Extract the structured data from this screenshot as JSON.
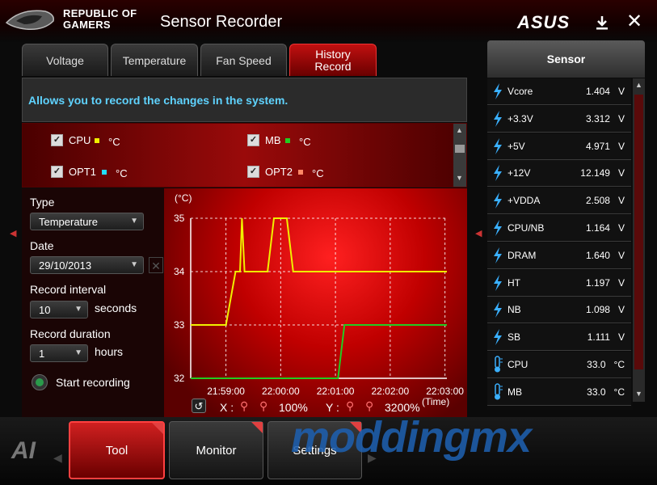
{
  "window": {
    "brand_line1": "REPUBLIC OF",
    "brand_line2": "GAMERS",
    "title": "Sensor Recorder",
    "vendor_logo": "ASUS"
  },
  "tabs": [
    {
      "label": "Voltage"
    },
    {
      "label": "Temperature"
    },
    {
      "label": "Fan Speed"
    },
    {
      "label_line1": "History",
      "label_line2": "Record",
      "active": true
    }
  ],
  "info": "Allows you to record the changes in the system.",
  "sensors_checked": [
    {
      "label": "CPU",
      "unit": "°C",
      "color": "#f0f000",
      "checked": true
    },
    {
      "label": "MB",
      "unit": "°C",
      "color": "#22cc22",
      "checked": true
    },
    {
      "label": "OPT1",
      "unit": "°C",
      "color": "#22ddff",
      "checked": true
    },
    {
      "label": "OPT2",
      "unit": "°C",
      "color": "#ff8866",
      "checked": true
    }
  ],
  "controls": {
    "type_label": "Type",
    "type_value": "Temperature",
    "date_label": "Date",
    "date_value": "29/10/2013",
    "interval_label": "Record interval",
    "interval_value": "10",
    "interval_unit": "seconds",
    "duration_label": "Record duration",
    "duration_value": "1",
    "duration_unit": "hours",
    "start_label": "Start recording"
  },
  "chart_data": {
    "type": "line",
    "ylabel": "(°C)",
    "xlabel": "(Time)",
    "ylim": [
      32,
      35
    ],
    "yticks": [
      "35",
      "34",
      "33",
      "32"
    ],
    "xticks": [
      "21:59:00",
      "22:00:00",
      "22:01:00",
      "22:02:00",
      "22:03:00"
    ],
    "grid": true,
    "series": [
      {
        "name": "CPU",
        "color": "#f0f000",
        "points": [
          [
            0,
            33
          ],
          [
            0.55,
            33
          ],
          [
            0.7,
            34
          ],
          [
            0.77,
            34
          ],
          [
            0.8,
            35
          ],
          [
            0.84,
            34
          ],
          [
            1.0,
            34
          ],
          [
            1.2,
            34
          ],
          [
            1.3,
            35
          ],
          [
            1.5,
            35
          ],
          [
            1.6,
            34
          ],
          [
            4.0,
            34
          ]
        ]
      },
      {
        "name": "MB",
        "color": "#22cc22",
        "points": [
          [
            0,
            32
          ],
          [
            2.3,
            32
          ],
          [
            2.4,
            33
          ],
          [
            4.0,
            33
          ]
        ]
      }
    ]
  },
  "zoom": {
    "x_label": "X :",
    "x_value": "100%",
    "y_label": "Y :",
    "y_value": "3200%"
  },
  "sensor_panel": {
    "title": "Sensor",
    "items": [
      {
        "name": "Vcore",
        "value": "1.404",
        "unit": "V",
        "icon": "lightning-icon"
      },
      {
        "name": "+3.3V",
        "value": "3.312",
        "unit": "V",
        "icon": "lightning-icon"
      },
      {
        "name": "+5V",
        "value": "4.971",
        "unit": "V",
        "icon": "lightning-icon"
      },
      {
        "name": "+12V",
        "value": "12.149",
        "unit": "V",
        "icon": "lightning-icon"
      },
      {
        "name": "+VDDA",
        "value": "2.508",
        "unit": "V",
        "icon": "lightning-icon"
      },
      {
        "name": "CPU/NB",
        "value": "1.164",
        "unit": "V",
        "icon": "lightning-icon"
      },
      {
        "name": "DRAM",
        "value": "1.640",
        "unit": "V",
        "icon": "lightning-icon"
      },
      {
        "name": "HT",
        "value": "1.197",
        "unit": "V",
        "icon": "lightning-icon"
      },
      {
        "name": "NB",
        "value": "1.098",
        "unit": "V",
        "icon": "lightning-icon"
      },
      {
        "name": "SB",
        "value": "1.111",
        "unit": "V",
        "icon": "lightning-icon"
      },
      {
        "name": "CPU",
        "value": "33.0",
        "unit": "°C",
        "icon": "thermometer-icon"
      },
      {
        "name": "MB",
        "value": "33.0",
        "unit": "°C",
        "icon": "thermometer-icon"
      }
    ]
  },
  "bottom_buttons": [
    {
      "label": "Tool"
    },
    {
      "label": "Monitor"
    },
    {
      "label": "Settings"
    }
  ],
  "watermark": "moddingmx"
}
